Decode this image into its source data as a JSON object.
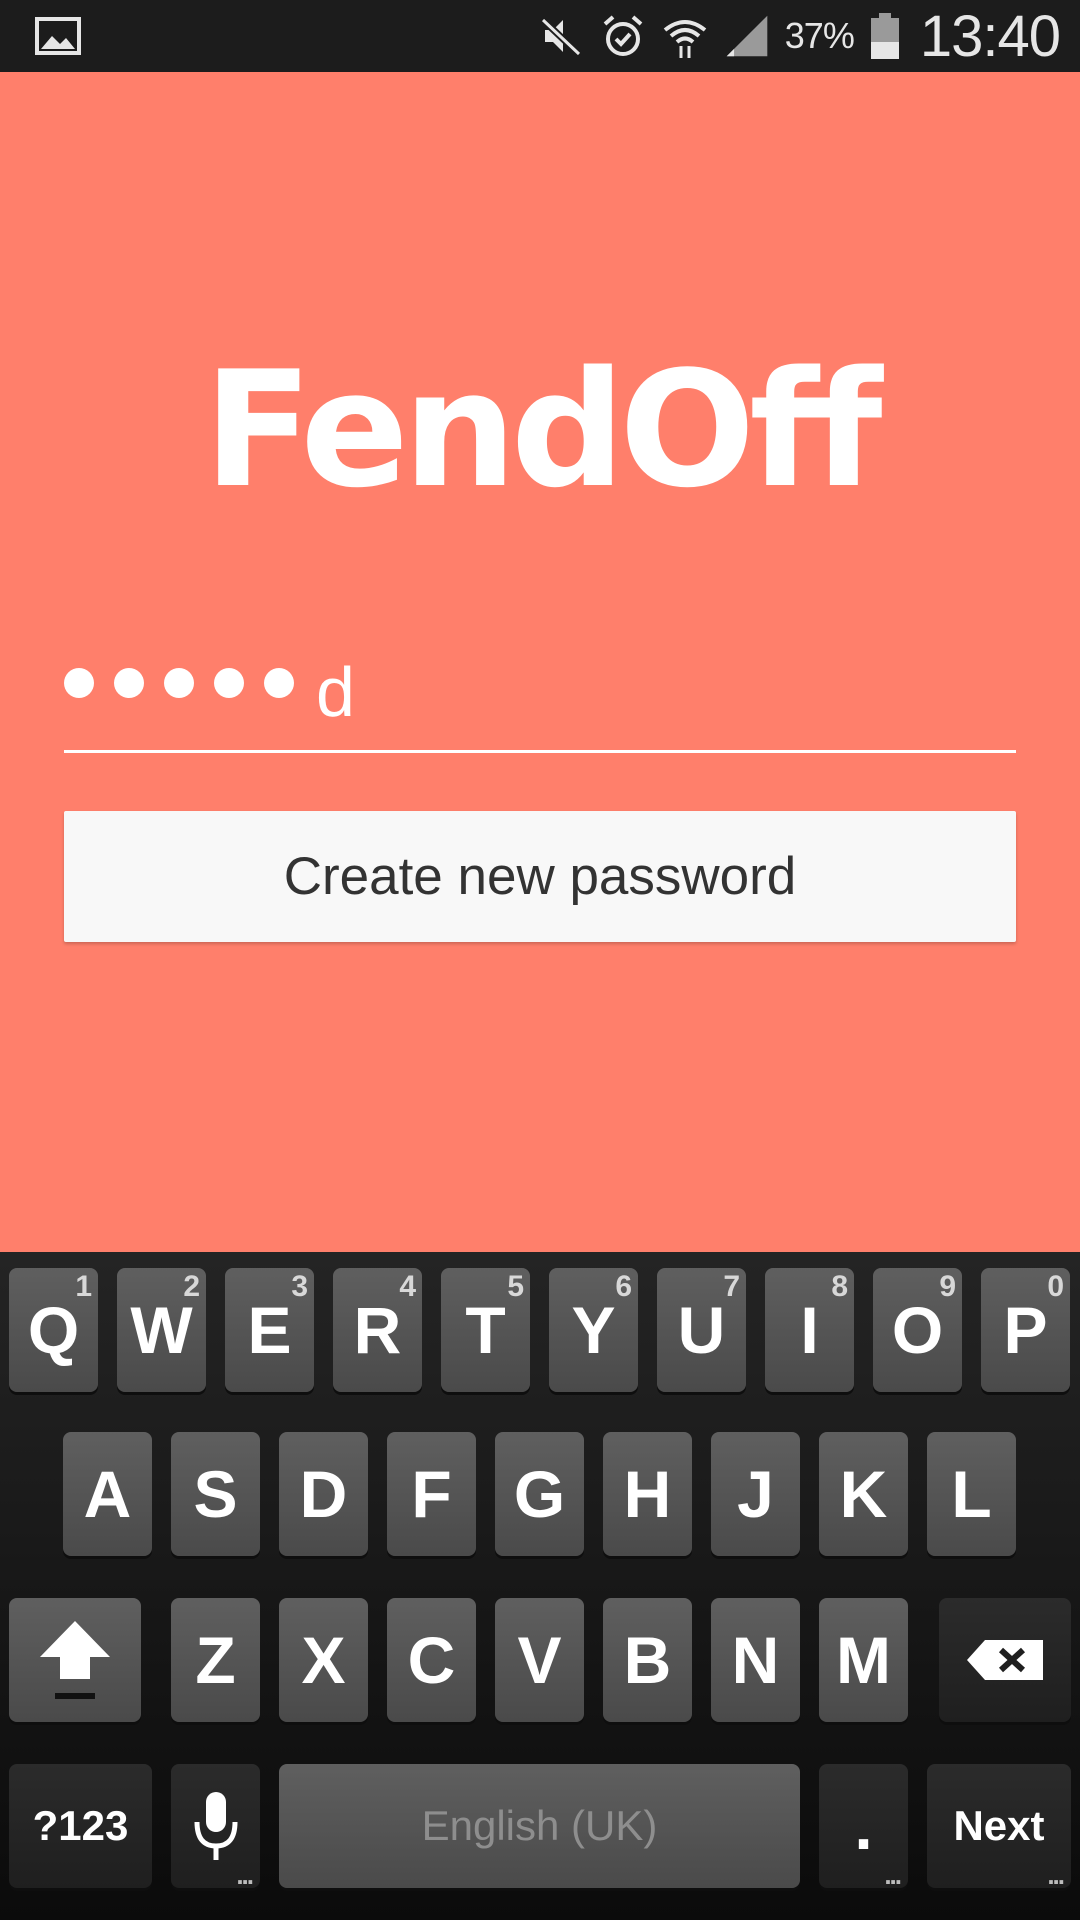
{
  "status_bar": {
    "battery_percent": "37%",
    "time": "13:40",
    "icons": [
      "gallery-icon",
      "mute-icon",
      "alarm-icon",
      "wifi-icon",
      "signal-icon",
      "battery-icon"
    ]
  },
  "app": {
    "title": "FendOff",
    "password_field": {
      "masked_count": 5,
      "typed_char": "d"
    },
    "primary_button": "Create new password"
  },
  "keyboard": {
    "row1": [
      {
        "label": "Q",
        "hint": "1"
      },
      {
        "label": "W",
        "hint": "2"
      },
      {
        "label": "E",
        "hint": "3"
      },
      {
        "label": "R",
        "hint": "4"
      },
      {
        "label": "T",
        "hint": "5"
      },
      {
        "label": "Y",
        "hint": "6"
      },
      {
        "label": "U",
        "hint": "7"
      },
      {
        "label": "I",
        "hint": "8"
      },
      {
        "label": "O",
        "hint": "9"
      },
      {
        "label": "P",
        "hint": "0"
      }
    ],
    "row2": [
      "A",
      "S",
      "D",
      "F",
      "G",
      "H",
      "J",
      "K",
      "L"
    ],
    "row3": [
      "Z",
      "X",
      "C",
      "V",
      "B",
      "N",
      "M"
    ],
    "symbols_key": "?123",
    "space_label": "English (UK)",
    "period_key": ".",
    "enter_key": "Next"
  },
  "colors": {
    "background": "#ff7f6b",
    "status_bar": "#1c1c1c",
    "key": "#555555"
  }
}
